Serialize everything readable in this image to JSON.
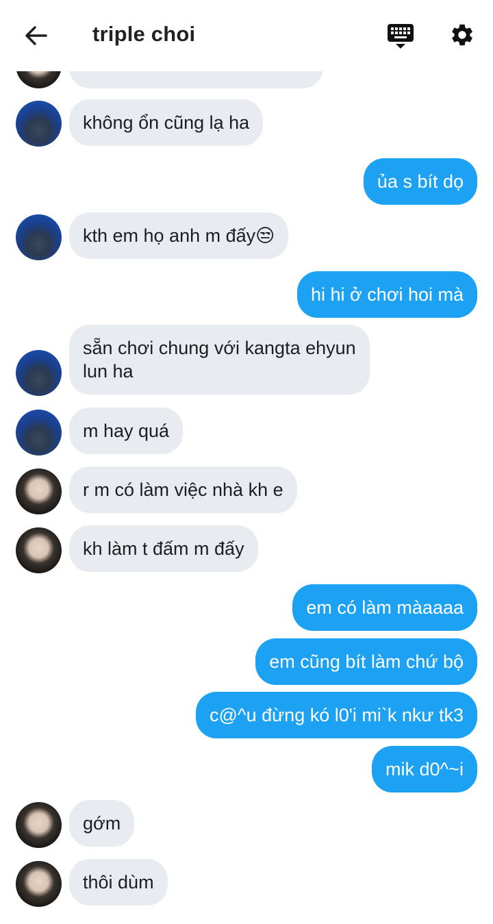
{
  "header": {
    "title": "triple choi",
    "back_icon": "arrow-left-icon",
    "keyboard_icon": "keyboard-icon",
    "settings_icon": "gear-icon"
  },
  "colors": {
    "outgoing_bubble": "#1da1f2",
    "incoming_bubble": "#e8ecf0"
  },
  "messages": [
    {
      "direction": "in",
      "sender": "user-a",
      "lines": [
        ""
      ]
    },
    {
      "direction": "in",
      "sender": "user-a",
      "lines": [
        "không ổn cũng lạ ha"
      ]
    },
    {
      "direction": "out",
      "lines": [
        "ủa s bít dọ"
      ]
    },
    {
      "direction": "in",
      "sender": "user-a",
      "lines": [
        "kth em họ anh m đấy😒"
      ]
    },
    {
      "direction": "out",
      "lines": [
        "hi hi ở chơi hoi mà"
      ]
    },
    {
      "direction": "in",
      "sender": "user-a",
      "lines": [
        "sẵn chơi chung với kangta ehyun",
        "lun ha"
      ]
    },
    {
      "direction": "in",
      "sender": "user-a",
      "lines": [
        "m hay quá"
      ]
    },
    {
      "direction": "in",
      "sender": "user-b",
      "lines": [
        "r m có làm việc nhà kh e"
      ]
    },
    {
      "direction": "in",
      "sender": "user-b",
      "lines": [
        "kh làm t đấm m đấy"
      ]
    },
    {
      "direction": "out",
      "lines": [
        "em có làm màaaaa"
      ]
    },
    {
      "direction": "out",
      "lines": [
        "em cũng bít làm chứ bộ"
      ]
    },
    {
      "direction": "out",
      "lines": [
        "c@^u đừng kó l0'i mi`k nkư tk3"
      ]
    },
    {
      "direction": "out",
      "lines": [
        "mik d0^~i"
      ]
    },
    {
      "direction": "in",
      "sender": "user-b",
      "lines": [
        "gớm"
      ]
    },
    {
      "direction": "in",
      "sender": "user-b",
      "lines": [
        "thôi dùm"
      ]
    }
  ]
}
